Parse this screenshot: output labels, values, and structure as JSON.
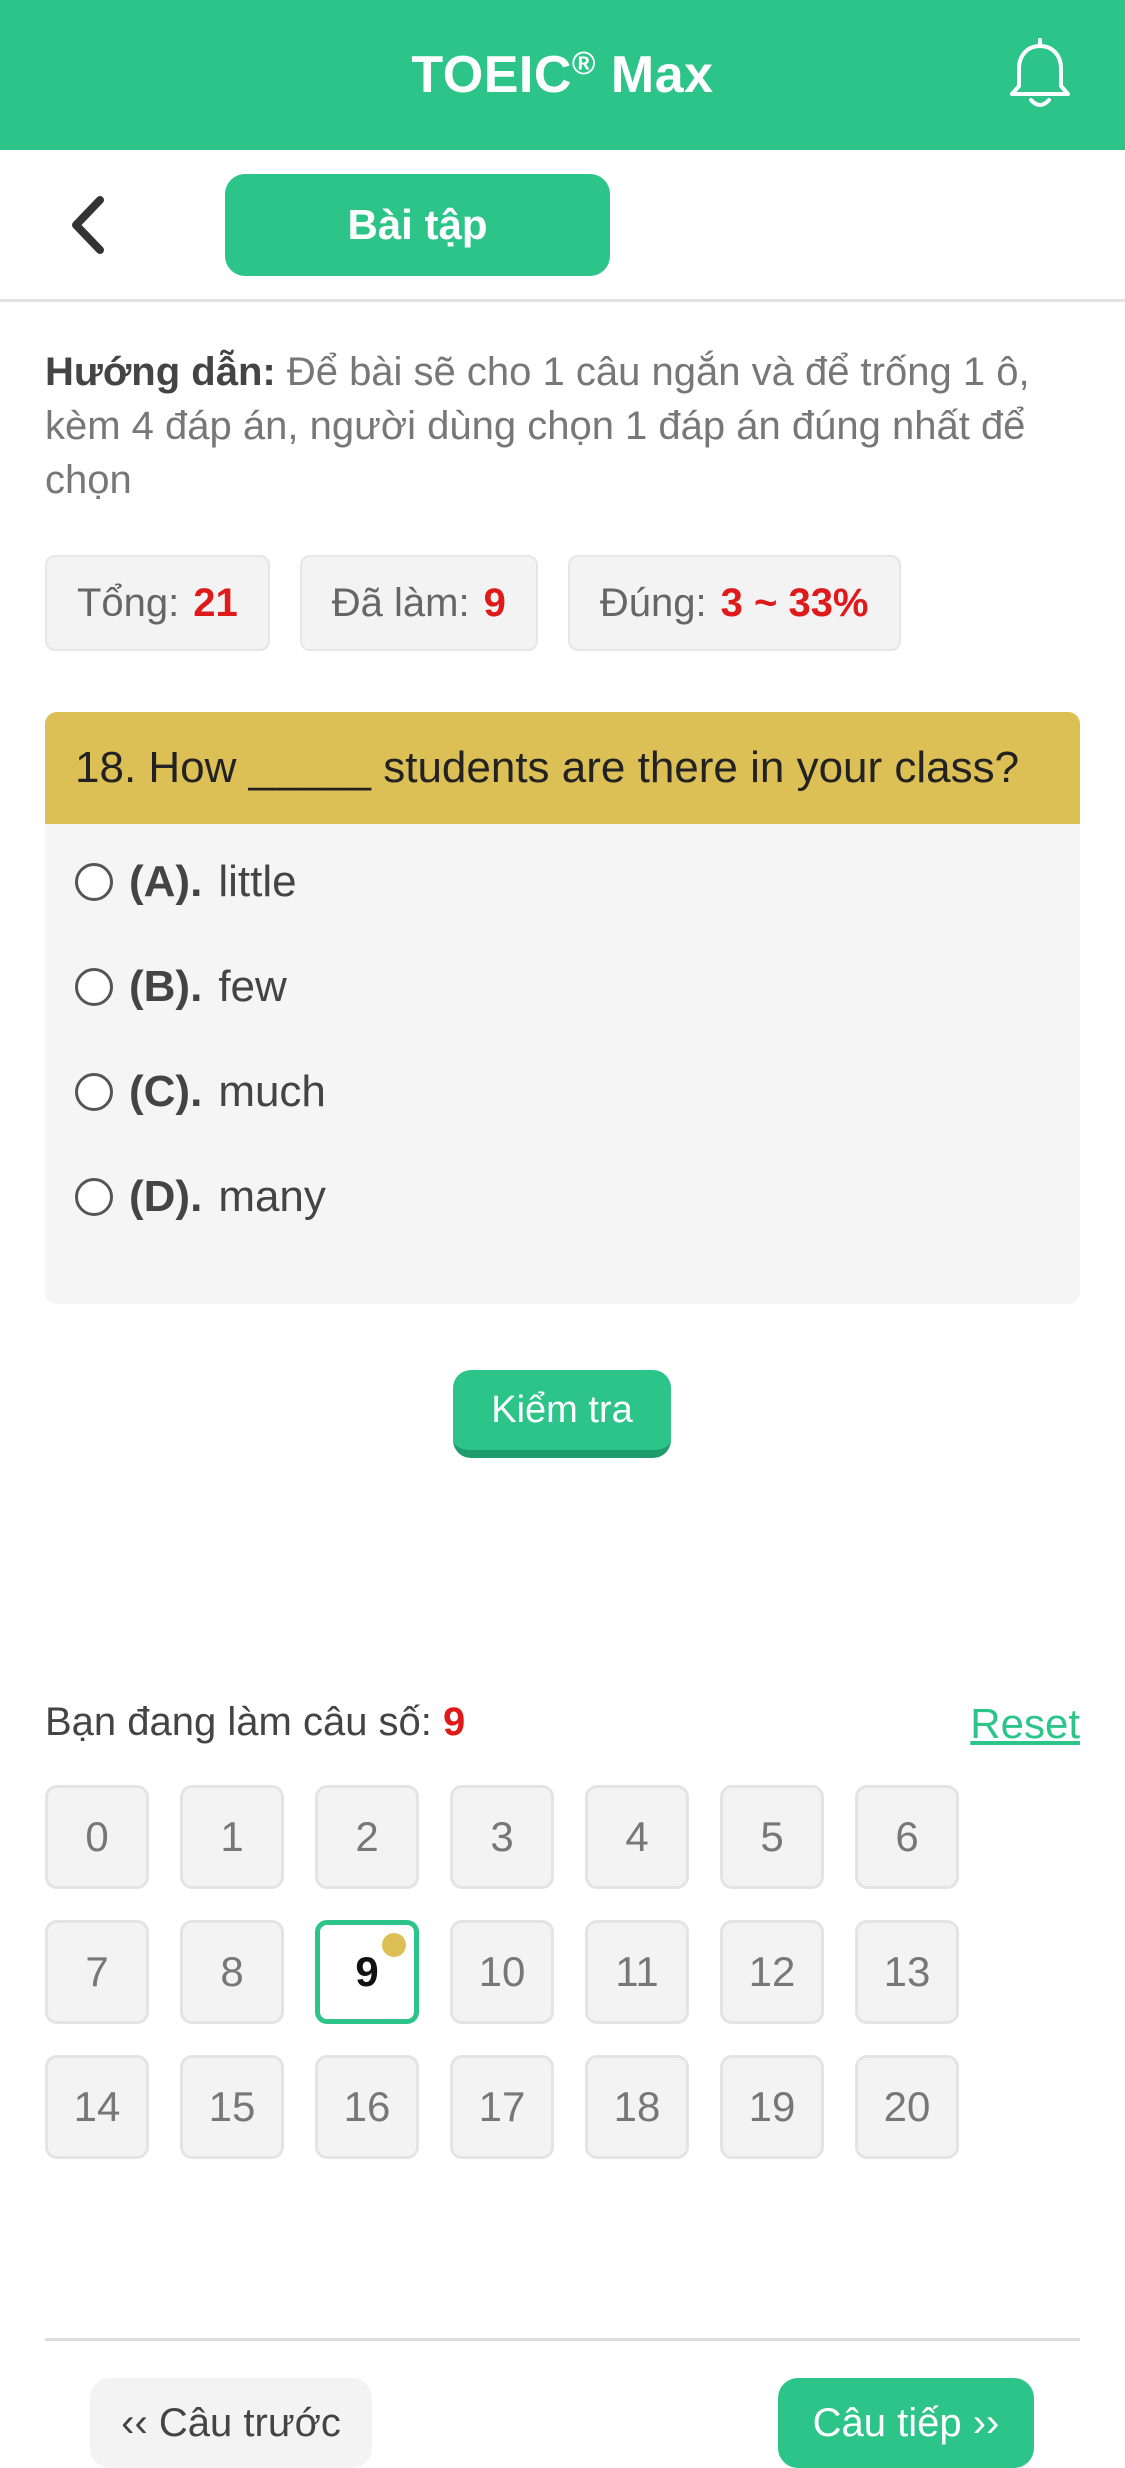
{
  "header": {
    "title": "TOEIC",
    "title_mark": "®",
    "title_suffix": " Max",
    "bell_icon": "bell-icon"
  },
  "toolbar": {
    "back_icon": "chevron-left-icon",
    "tab_label": "Bài tập"
  },
  "instructions": {
    "label": "Hướng dẫn:",
    "text": " Để bài sẽ cho 1 câu ngắn và để trống 1 ô, kèm 4 đáp án, người dùng chọn 1 đáp án đúng nhất để chọn"
  },
  "stats": {
    "total_label": "Tổng:",
    "total_value": "21",
    "done_label": "Đã làm:",
    "done_value": "9",
    "correct_label": "Đúng:",
    "correct_value": "3 ~ 33%"
  },
  "question": {
    "text": "18. How _____ students are there in your class?",
    "options": [
      {
        "letter": "(A).",
        "text": "little"
      },
      {
        "letter": "(B).",
        "text": "few"
      },
      {
        "letter": "(C).",
        "text": "much"
      },
      {
        "letter": "(D).",
        "text": "many"
      }
    ]
  },
  "check_label": "Kiểm tra",
  "progress": {
    "label": "Bạn đang làm câu số:",
    "current": "9",
    "reset_label": "Reset"
  },
  "question_numbers": [
    "0",
    "1",
    "2",
    "3",
    "4",
    "5",
    "6",
    "7",
    "8",
    "9",
    "10",
    "11",
    "12",
    "13",
    "14",
    "15",
    "16",
    "17",
    "18",
    "19",
    "20"
  ],
  "current_index": 9,
  "nav": {
    "prev_label": "‹‹ Câu trước",
    "next_label": "Câu tiếp ››"
  },
  "colors": {
    "primary": "#2dc48a",
    "accent": "#dcbf55",
    "highlight": "#e01a1a"
  }
}
